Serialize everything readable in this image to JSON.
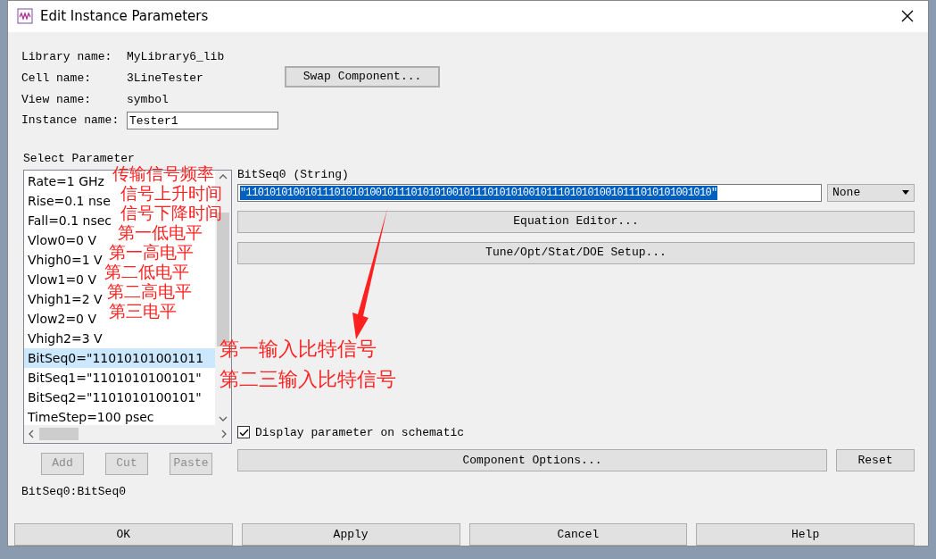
{
  "window": {
    "title": "Edit Instance Parameters"
  },
  "info": [
    {
      "label": "Library name:",
      "value": "MyLibrary6_lib"
    },
    {
      "label": "Cell name:",
      "value": "3LineTester"
    },
    {
      "label": "View name:",
      "value": "symbol"
    }
  ],
  "instance": {
    "label": "Instance name:",
    "value": "Tester1"
  },
  "swap_button": "Swap Component...",
  "select_parameter": {
    "title": "Select Parameter",
    "items": [
      {
        "text": "Rate=1 GHz",
        "selected": false
      },
      {
        "text": "Rise=0.1 nse",
        "selected": false
      },
      {
        "text": "Fall=0.1 nsec",
        "selected": false
      },
      {
        "text": "Vlow0=0 V",
        "selected": false
      },
      {
        "text": "Vhigh0=1 V",
        "selected": false
      },
      {
        "text": "Vlow1=0 V",
        "selected": false
      },
      {
        "text": "Vhigh1=2 V",
        "selected": false
      },
      {
        "text": "Vlow2=0 V",
        "selected": false
      },
      {
        "text": "Vhigh2=3 V",
        "selected": false
      },
      {
        "text": "BitSeq0=\"11010101001011",
        "selected": true
      },
      {
        "text": "BitSeq1=\"1101010100101\"",
        "selected": false
      },
      {
        "text": "BitSeq2=\"1101010100101\"",
        "selected": false
      },
      {
        "text": "TimeStep=100 psec",
        "selected": false
      }
    ],
    "buttons": [
      {
        "label": "Add",
        "disabled": true
      },
      {
        "label": "Cut",
        "disabled": true
      },
      {
        "label": "Paste",
        "disabled": true
      }
    ],
    "status": "BitSeq0:BitSeq0"
  },
  "parameter": {
    "label": "BitSeq0 (String)",
    "value": "\"1101010100101110101010010111010101001011101010100101110101010010111010101001010\"",
    "unit": "None",
    "equation_button": "Equation Editor...",
    "tune_button": "Tune/Opt/Stat/DOE Setup...",
    "display_on_schematic": {
      "label": "Display parameter on schematic",
      "checked": true
    },
    "component_options": "Component Options...",
    "reset": "Reset"
  },
  "annotations": [
    "传输信号频率",
    "信号上升时间",
    "信号下降时间",
    "第一低电平",
    "第一高电平",
    "第二低电平",
    "第二高电平",
    "第三电平"
  ],
  "arrow_annotations": [
    "第一输入比特信号",
    "第二三输入比特信号"
  ],
  "footer_buttons": [
    "OK",
    "Apply",
    "Cancel",
    "Help"
  ]
}
